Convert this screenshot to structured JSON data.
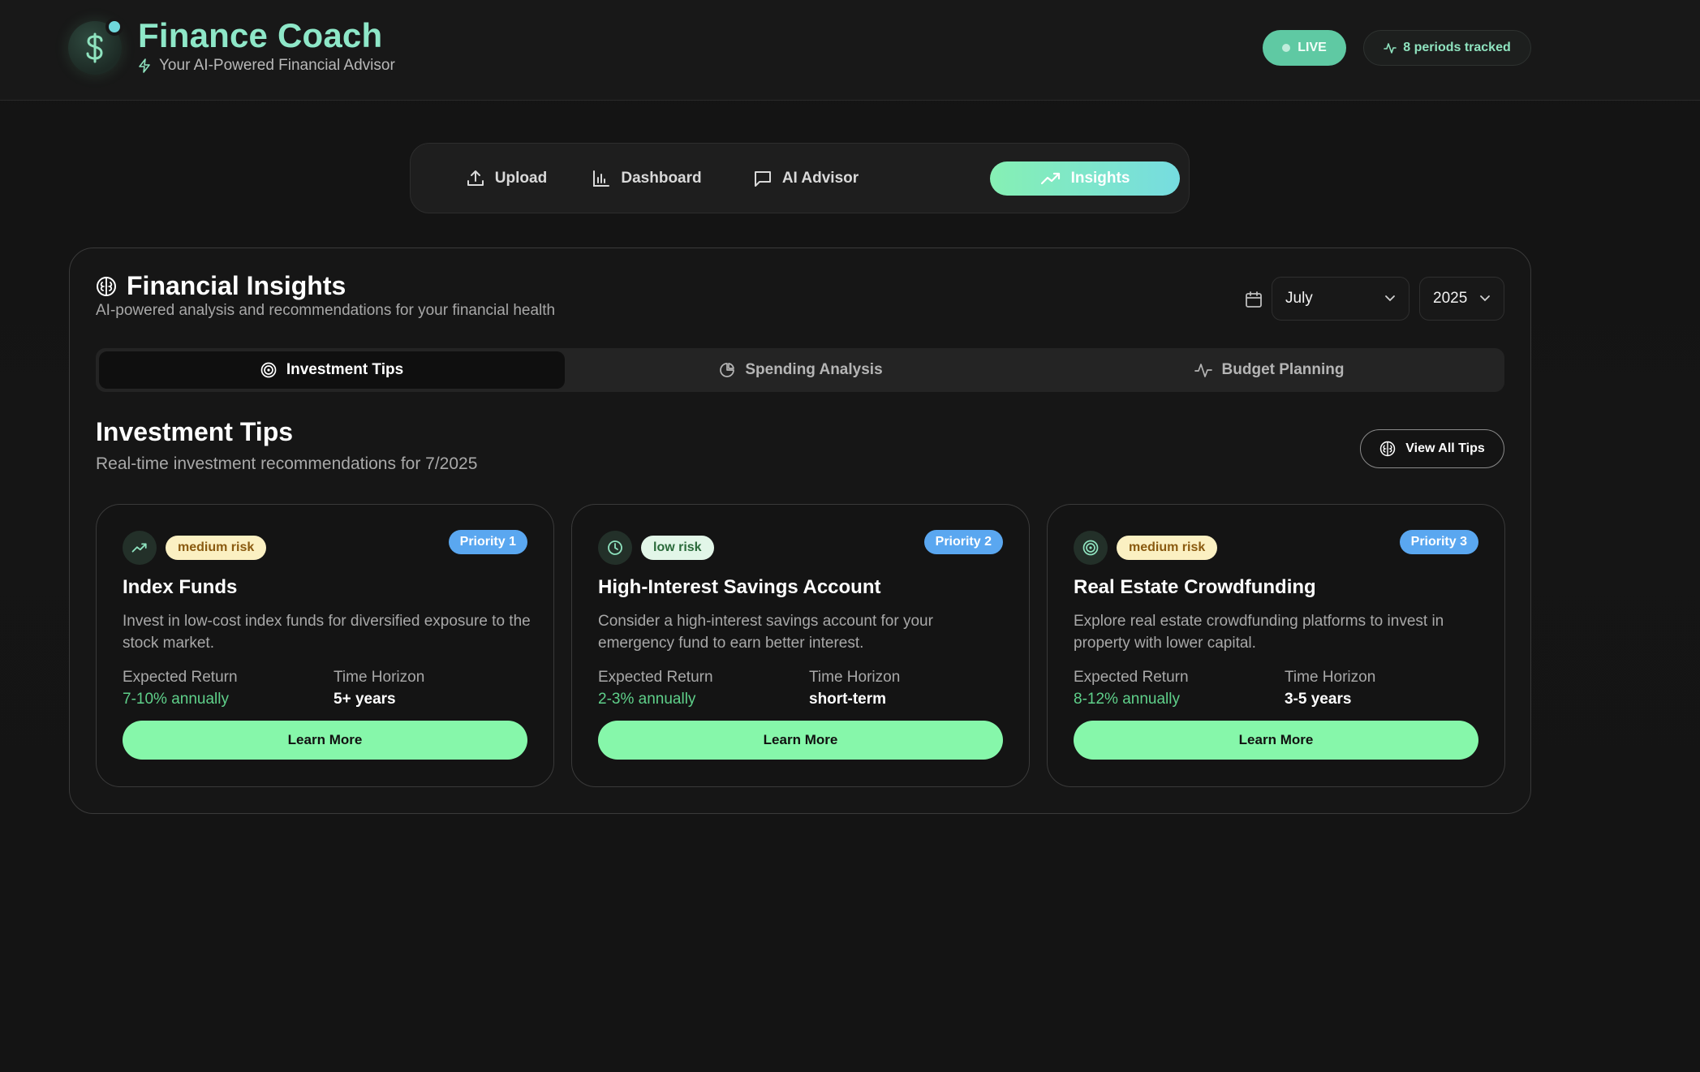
{
  "header": {
    "title": "Finance Coach",
    "subtitle": "Your AI-Powered Financial Advisor",
    "live_label": "LIVE",
    "periods_label": "8 periods tracked",
    "logo_icon": "dollar-icon"
  },
  "nav": {
    "items": [
      {
        "label": "Upload",
        "icon": "upload-icon"
      },
      {
        "label": "Dashboard",
        "icon": "bar-chart-icon"
      },
      {
        "label": "AI Advisor",
        "icon": "chat-icon"
      },
      {
        "label": "Insights",
        "icon": "trending-up-icon",
        "active": true
      }
    ]
  },
  "panel": {
    "title": "Financial Insights",
    "subtitle": "AI-powered analysis and recommendations for your financial health",
    "month": "July",
    "year": "2025",
    "tabs": [
      {
        "label": "Investment Tips",
        "icon": "target-icon",
        "active": true
      },
      {
        "label": "Spending Analysis",
        "icon": "pie-chart-icon"
      },
      {
        "label": "Budget Planning",
        "icon": "activity-icon"
      }
    ]
  },
  "section": {
    "title": "Investment Tips",
    "subtitle": "Real-time investment recommendations for 7/2025",
    "view_all": "View All Tips"
  },
  "cards": [
    {
      "risk": "medium risk",
      "priority": "Priority 1",
      "title": "Index Funds",
      "description": "Invest in low-cost index funds for diversified exposure to the stock market.",
      "return_label": "Expected Return",
      "return_value": "7-10% annually",
      "horizon_label": "Time Horizon",
      "horizon_value": "5+ years",
      "button": "Learn More",
      "icon": "trending-up-icon"
    },
    {
      "risk": "low risk",
      "priority": "Priority 2",
      "title": "High-Interest Savings Account",
      "description": "Consider a high-interest savings account for your emergency fund to earn better interest.",
      "return_label": "Expected Return",
      "return_value": "2-3% annually",
      "horizon_label": "Time Horizon",
      "horizon_value": "short-term",
      "button": "Learn More",
      "icon": "clock-icon"
    },
    {
      "risk": "medium risk",
      "priority": "Priority 3",
      "title": "Real Estate Crowdfunding",
      "description": "Explore real estate crowdfunding platforms to invest in property with lower capital.",
      "return_label": "Expected Return",
      "return_value": "8-12% annually",
      "horizon_label": "Time Horizon",
      "horizon_value": "3-5 years",
      "button": "Learn More",
      "icon": "target-icon"
    }
  ],
  "colors": {
    "accent_green": "#86f7aa",
    "accent_teal": "#76dce0",
    "priority_blue": "#5aa7f0",
    "return_green": "#5fd08a"
  }
}
